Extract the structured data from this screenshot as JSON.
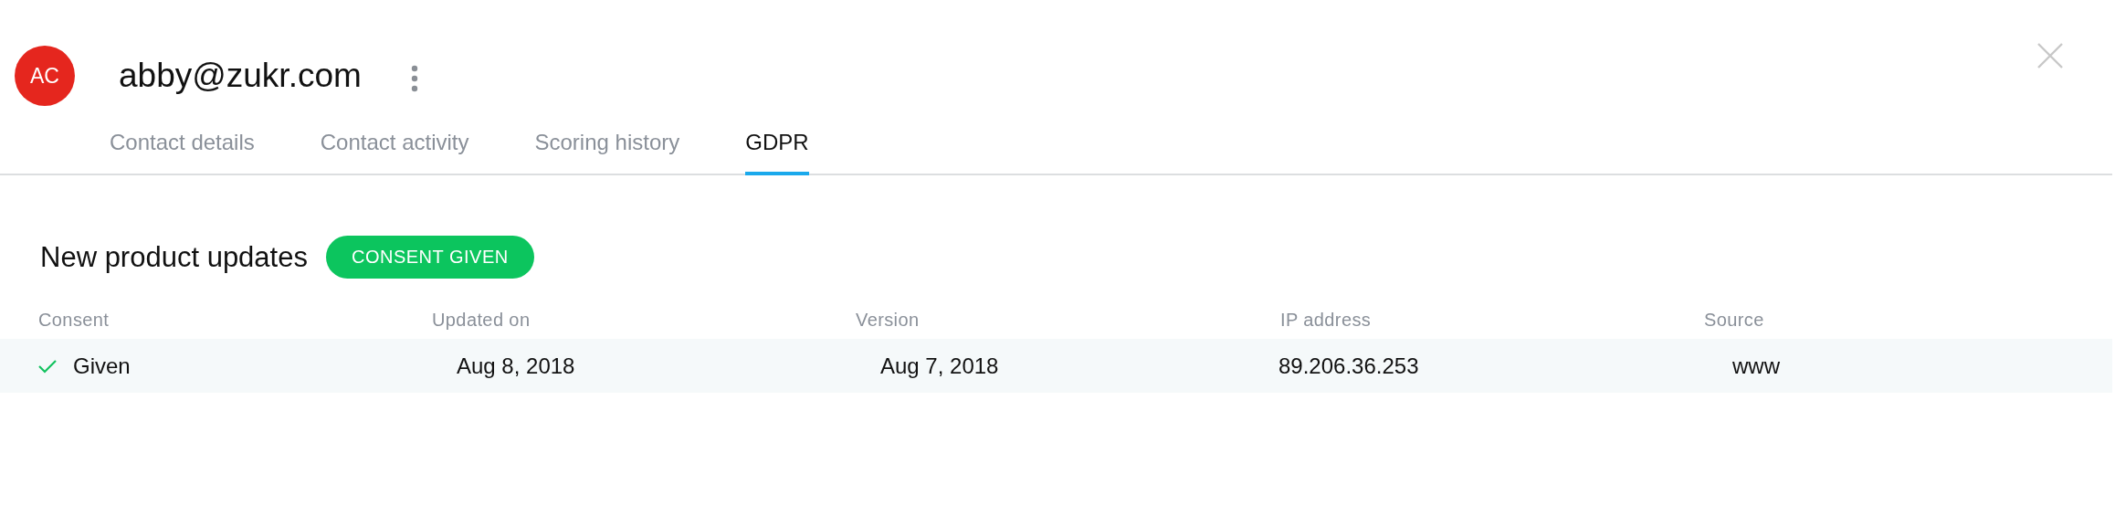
{
  "contact": {
    "initials": "AC",
    "email": "abby@zukr.com"
  },
  "tabs": [
    {
      "label": "Contact details",
      "selected": false
    },
    {
      "label": "Contact activity",
      "selected": false
    },
    {
      "label": "Scoring history",
      "selected": false
    },
    {
      "label": "GDPR",
      "selected": true
    }
  ],
  "consent_section": {
    "title": "New product updates",
    "badge": "CONSENT GIVEN",
    "table": {
      "columns": [
        "Consent",
        "Updated on",
        "Version",
        "IP address",
        "Source"
      ],
      "rows": [
        {
          "given": true,
          "cells": [
            "Given",
            "Aug 8, 2018",
            "Aug 7, 2018",
            "89.206.36.253",
            "www"
          ]
        }
      ]
    }
  }
}
